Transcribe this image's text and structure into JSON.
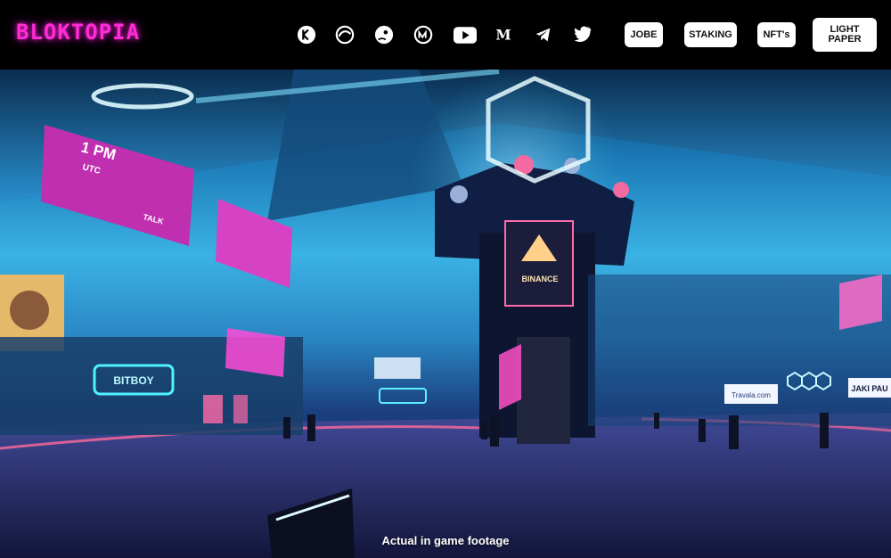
{
  "brand": {
    "logo_text": "BLOKTOPIA"
  },
  "nav": {
    "social_icons": [
      {
        "name": "kucoin-icon"
      },
      {
        "name": "coingecko-ring-icon"
      },
      {
        "name": "coingecko-gecko-icon"
      },
      {
        "name": "coinmarketcap-icon"
      },
      {
        "name": "youtube-icon"
      },
      {
        "name": "medium-icon"
      },
      {
        "name": "telegram-icon"
      },
      {
        "name": "twitter-icon"
      }
    ],
    "buttons": {
      "jobe": "JOBE",
      "staking": "STAKING",
      "nfts": "NFT's",
      "light_paper_line1": "LIGHT",
      "light_paper_line2": "PAPER"
    }
  },
  "hero": {
    "caption": "Actual in game footage",
    "signs": {
      "time_sign": "1 PM",
      "utc_sign": "UTC",
      "talk_sign": "TALK",
      "binance_sign": "BINANCE",
      "bitboy_sign": "BITBOY",
      "jaki_sign": "JAKI PAU",
      "travala_sign": "Travala.com"
    }
  },
  "colors": {
    "brand_pink": "#ff2bd6",
    "cyan": "#3bb2e4",
    "button_bg": "#ffffff"
  }
}
